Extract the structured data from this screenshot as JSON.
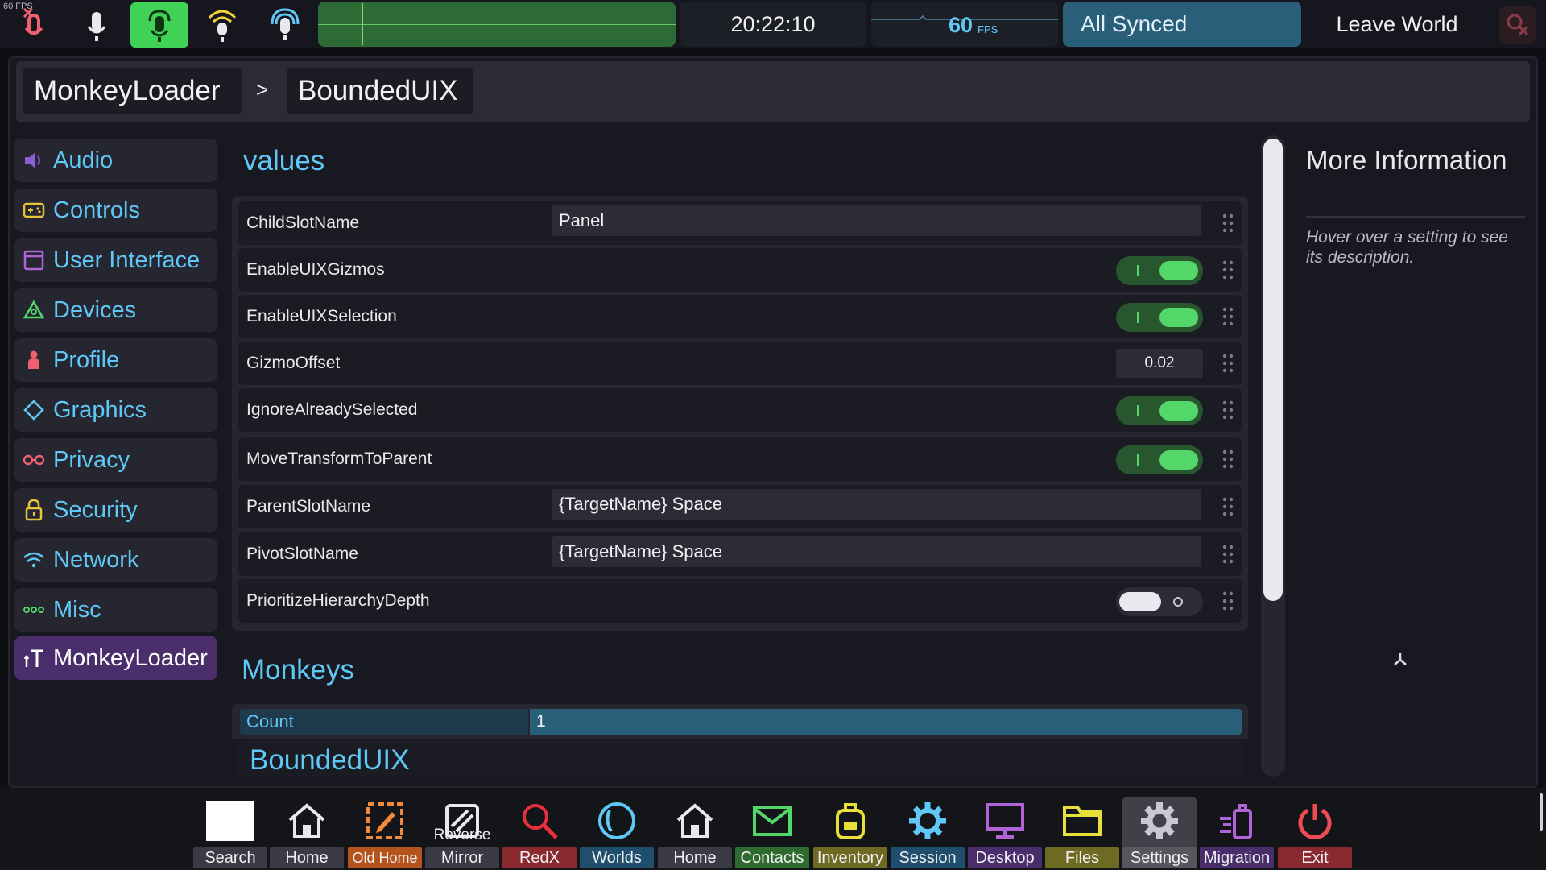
{
  "topbar": {
    "fps_small": "60 FPS",
    "clock": "20:22:10",
    "fps_value": "60",
    "fps_unit": "FPS",
    "sync_status": "All Synced",
    "leave_label": "Leave World",
    "colors": {
      "mic_active": "#3fd256",
      "sync_bg": "#2a5f7a",
      "wave_bg": "#2e6a34",
      "accent": "#5fc8f6"
    }
  },
  "breadcrumb": {
    "root": "MonkeyLoader",
    "separator": ">",
    "current": "BoundedUIX"
  },
  "sidebar": {
    "items": [
      {
        "label": "Audio",
        "icon": "speaker-icon"
      },
      {
        "label": "Controls",
        "icon": "gamepad-icon"
      },
      {
        "label": "User Interface",
        "icon": "window-icon"
      },
      {
        "label": "Devices",
        "icon": "devices-icon"
      },
      {
        "label": "Profile",
        "icon": "person-icon"
      },
      {
        "label": "Graphics",
        "icon": "diamond-icon"
      },
      {
        "label": "Privacy",
        "icon": "glasses-icon"
      },
      {
        "label": "Security",
        "icon": "lock-icon"
      },
      {
        "label": "Network",
        "icon": "wifi-icon"
      },
      {
        "label": "Misc",
        "icon": "dots-icon"
      },
      {
        "label": "MonkeyLoader",
        "icon": "monkeyloader-icon",
        "active": true
      }
    ]
  },
  "values_section": {
    "title": "values",
    "rows": [
      {
        "label": "ChildSlotName",
        "type": "text",
        "value": "Panel"
      },
      {
        "label": "EnableUIXGizmos",
        "type": "toggle",
        "value": true
      },
      {
        "label": "EnableUIXSelection",
        "type": "toggle",
        "value": true
      },
      {
        "label": "GizmoOffset",
        "type": "number",
        "value": "0.02"
      },
      {
        "label": "IgnoreAlreadySelected",
        "type": "toggle",
        "value": true
      },
      {
        "label": "MoveTransformToParent",
        "type": "toggle",
        "value": true
      },
      {
        "label": "ParentSlotName",
        "type": "text",
        "value": "{TargetName} Space"
      },
      {
        "label": "PivotSlotName",
        "type": "text",
        "value": "{TargetName} Space"
      },
      {
        "label": "PrioritizeHierarchyDepth",
        "type": "toggle",
        "value": false
      }
    ]
  },
  "monkeys_section": {
    "title": "Monkeys",
    "count_label": "Count",
    "count_value": "1",
    "module_title": "BoundedUIX"
  },
  "info_panel": {
    "title": "More Information",
    "description": "Hover over a setting to see its description."
  },
  "dock": {
    "items": [
      {
        "label": "Search",
        "icon": "blank-square-icon",
        "color": "#3a3b44"
      },
      {
        "label": "Home",
        "icon": "home-icon",
        "color": "#3a3b44"
      },
      {
        "label": "Old Home",
        "icon": "edit-icon",
        "color": "#b5531d"
      },
      {
        "label": "Mirror",
        "sublabel": "Reverse",
        "icon": "mirror-icon",
        "color": "#3a3b44"
      },
      {
        "label": "RedX",
        "icon": "magnifier-icon",
        "color": "#8a2a2e"
      },
      {
        "label": "Worlds",
        "icon": "globe-icon",
        "color": "#1f4f6d"
      },
      {
        "label": "Home",
        "icon": "home-icon",
        "color": "#3a3b44"
      },
      {
        "label": "Contacts",
        "icon": "mail-icon",
        "color": "#2f6b2f"
      },
      {
        "label": "Inventory",
        "icon": "backpack-icon",
        "color": "#6f6a22"
      },
      {
        "label": "Session",
        "icon": "gear-icon",
        "color": "#1f4f6d"
      },
      {
        "label": "Desktop",
        "icon": "monitor-icon",
        "color": "#4a2e6b"
      },
      {
        "label": "Files",
        "icon": "folder-icon",
        "color": "#6f6a22"
      },
      {
        "label": "Settings",
        "icon": "settings-icon",
        "color": "#55565e",
        "active": true
      },
      {
        "label": "Migration",
        "icon": "migration-icon",
        "color": "#4a2e6b"
      },
      {
        "label": "Exit",
        "icon": "power-icon",
        "color": "#8a2a2e"
      }
    ]
  }
}
